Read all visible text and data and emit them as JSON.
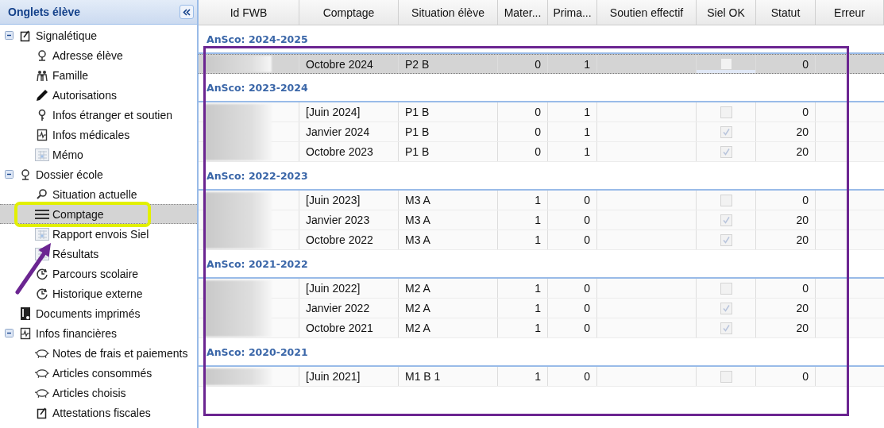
{
  "sidebar": {
    "title": "Onglets élève",
    "items": [
      {
        "label": "Signalétique",
        "kind": "form",
        "expanded": true,
        "selected": false,
        "children": [
          {
            "label": "Adresse élève",
            "kind": "pin",
            "selected": false
          },
          {
            "label": "Famille",
            "kind": "people",
            "selected": false
          },
          {
            "label": "Autorisations",
            "kind": "pen",
            "selected": false
          },
          {
            "label": "Infos étranger et soutien",
            "kind": "key",
            "selected": false
          },
          {
            "label": "Infos médicales",
            "kind": "pulse",
            "selected": false
          },
          {
            "label": "Mémo",
            "kind": "table",
            "selected": false
          }
        ]
      },
      {
        "label": "Dossier école",
        "kind": "pin",
        "expanded": true,
        "selected": false,
        "children": [
          {
            "label": "Situation actuelle",
            "kind": "search",
            "selected": false
          },
          {
            "label": "Comptage",
            "kind": "lines",
            "selected": true
          },
          {
            "label": "Rapport envois Siel",
            "kind": "table",
            "selected": false
          },
          {
            "label": "Résultats",
            "kind": "table",
            "selected": false
          },
          {
            "label": "Parcours scolaire",
            "kind": "clock",
            "selected": false
          },
          {
            "label": "Historique externe",
            "kind": "clock",
            "selected": false
          }
        ]
      },
      {
        "label": "Documents imprimés",
        "kind": "doc",
        "selected": false
      },
      {
        "label": "Infos financières",
        "kind": "pulse",
        "expanded": true,
        "selected": false,
        "children": [
          {
            "label": "Notes de frais et paiements",
            "kind": "piggy",
            "selected": false
          },
          {
            "label": "Articles consommés",
            "kind": "piggy",
            "selected": false
          },
          {
            "label": "Articles choisis",
            "kind": "piggy",
            "selected": false
          },
          {
            "label": "Attestations fiscales",
            "kind": "form",
            "selected": false
          }
        ]
      }
    ]
  },
  "table": {
    "columns": [
      "Id FWB",
      "Comptage",
      "Situation élève",
      "Mater...",
      "Prima...",
      "Soutien effectif",
      "Siel OK",
      "Statut",
      "Erreur"
    ],
    "groups": [
      {
        "title": "AnSco: 2024-2025",
        "id_blurred": true,
        "rows": [
          {
            "comptage": "Octobre 2024",
            "situation": "P2 B",
            "mater": "0",
            "prima": "1",
            "siel_ok": false,
            "statut": "0",
            "selected": true
          }
        ]
      },
      {
        "title": "AnSco: 2023-2024",
        "id_blurred": true,
        "rows": [
          {
            "comptage": "[Juin 2024]",
            "situation": "P1 B",
            "mater": "0",
            "prima": "1",
            "siel_ok": false,
            "statut": "0",
            "selected": false
          },
          {
            "comptage": "Janvier 2024",
            "situation": "P1 B",
            "mater": "0",
            "prima": "1",
            "siel_ok": true,
            "statut": "20",
            "selected": false
          },
          {
            "comptage": "Octobre 2023",
            "situation": "P1 B",
            "mater": "0",
            "prima": "1",
            "siel_ok": true,
            "statut": "20",
            "selected": false
          }
        ]
      },
      {
        "title": "AnSco: 2022-2023",
        "id_blurred": true,
        "rows": [
          {
            "comptage": "[Juin 2023]",
            "situation": "M3 A",
            "mater": "1",
            "prima": "0",
            "siel_ok": false,
            "statut": "0",
            "selected": false
          },
          {
            "comptage": "Janvier 2023",
            "situation": "M3 A",
            "mater": "1",
            "prima": "0",
            "siel_ok": true,
            "statut": "20",
            "selected": false
          },
          {
            "comptage": "Octobre 2022",
            "situation": "M3 A",
            "mater": "1",
            "prima": "0",
            "siel_ok": true,
            "statut": "20",
            "selected": false
          }
        ]
      },
      {
        "title": "AnSco: 2021-2022",
        "id_blurred": true,
        "rows": [
          {
            "comptage": "[Juin 2022]",
            "situation": "M2 A",
            "mater": "1",
            "prima": "0",
            "siel_ok": false,
            "statut": "0",
            "selected": false
          },
          {
            "comptage": "Janvier 2022",
            "situation": "M2 A",
            "mater": "1",
            "prima": "0",
            "siel_ok": true,
            "statut": "20",
            "selected": false
          },
          {
            "comptage": "Octobre 2021",
            "situation": "M2 A",
            "mater": "1",
            "prima": "0",
            "siel_ok": true,
            "statut": "20",
            "selected": false
          }
        ]
      },
      {
        "title": "AnSco: 2020-2021",
        "id_blurred": true,
        "rows": [
          {
            "comptage": "[Juin 2021]",
            "situation": "M1 B 1",
            "mater": "1",
            "prima": "0",
            "siel_ok": false,
            "statut": "0",
            "selected": false
          }
        ]
      }
    ]
  },
  "annotations": [
    {
      "kind": "highlight",
      "color": "#e2f000"
    },
    {
      "kind": "arrow",
      "color": "#6b2591"
    },
    {
      "kind": "frame",
      "color": "#6b2591"
    }
  ]
}
